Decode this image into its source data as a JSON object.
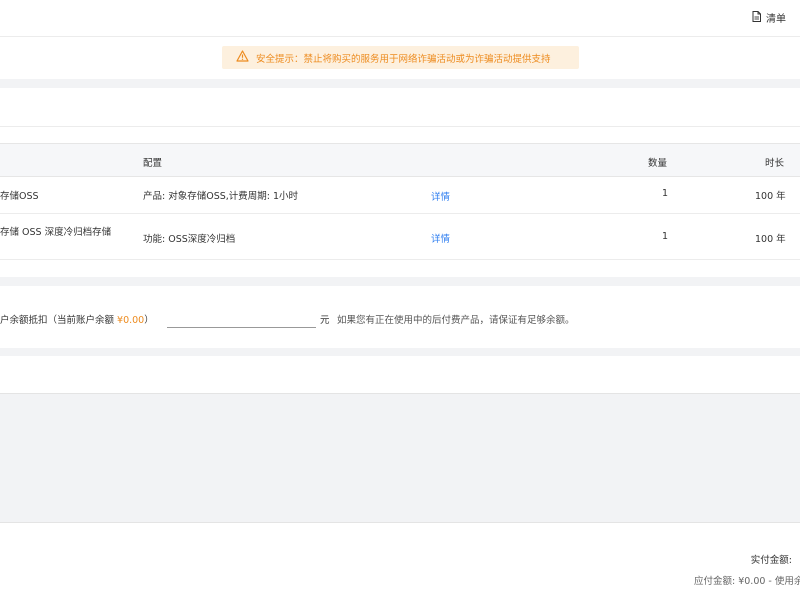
{
  "header": {
    "checklist_label": "清单"
  },
  "alert": {
    "text": "安全提示：禁止将购买的服务用于网络诈骗活动或为诈骗活动提供支持",
    "color": "#ed8b1f",
    "background": "#fdf0de"
  },
  "table": {
    "headers": {
      "config": "配置",
      "quantity": "数量",
      "duration": "时长"
    },
    "rows": [
      {
        "product": "存储OSS",
        "config": "产品: 对象存储OSS,计费周期: 1小时",
        "detail": "详情",
        "quantity": "1",
        "duration": "100 年"
      },
      {
        "product": "存储 OSS 深度冷归档存储",
        "config": "功能: OSS深度冷归档",
        "detail": "详情",
        "quantity": "1",
        "duration": "100 年"
      }
    ]
  },
  "balance": {
    "label_prefix": "户余额抵扣（当前账户余额 ",
    "amount": "¥0.00",
    "label_suffix": "）",
    "input_value": "",
    "unit": "元",
    "hint": "如果您有正在使用中的后付费产品，请保证有足够余额。"
  },
  "footer": {
    "paid_label": "实付金额:",
    "payable_text": "应付金额: ¥0.00 - 使用余"
  },
  "colors": {
    "accent": "#ed8b1f",
    "link": "#2e7ef0",
    "background": "#f2f3f5"
  }
}
